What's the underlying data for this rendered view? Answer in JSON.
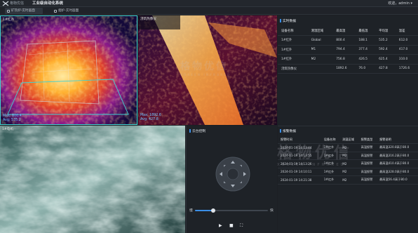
{
  "header": {
    "brand": "格物优信",
    "system_title": "工业级自动化系统",
    "user": "欢迎，admin",
    "user_caret": "▾"
  },
  "tabs": [
    {
      "label": "矿热炉-实时画面",
      "active": true
    },
    {
      "label": "烟炉-实时画面",
      "active": false
    }
  ],
  "videos": {
    "v1": {
      "label": "1#红外",
      "max": "Max: 800.4",
      "avg": "Avg: 535.2"
    },
    "v2": {
      "label": "浇筑热像仪",
      "max": "Max: 1892.6",
      "avg": "Avg: 427.8"
    },
    "v3": {
      "label": "1#电机"
    }
  },
  "watermark": {
    "cn": "格物优信",
    "en": "XOSEEN INFRARED"
  },
  "control": {
    "title": "云台控制",
    "slow_label": "慢",
    "fast_label": "快",
    "speed_value": 0.25,
    "play_icon": "▶",
    "stop_icon": "■",
    "fullscreen_icon": "⛶"
  },
  "realtime": {
    "title": "实时数据",
    "columns": [
      "设备名称",
      "测温区域",
      "最高温",
      "最低温",
      "平均温",
      "温差"
    ],
    "rows": [
      [
        "1#红外",
        "Global",
        "800.4",
        "188.1",
        "535.2",
        "612.0"
      ],
      [
        "1#红外",
        "M1",
        "794.4",
        "377.4",
        "592.4",
        "417.0"
      ],
      [
        "1#红外",
        "M2",
        "756.8",
        "426.5",
        "625.4",
        "310.0"
      ],
      [
        "浇筑热像仪",
        "",
        "1892.6",
        "76.0",
        "427.8",
        "1726.6"
      ]
    ]
  },
  "alarms": {
    "title": "报警数据",
    "columns": [
      "报警时间",
      "设备名称",
      "测温区域",
      "报警类型",
      "报警说明"
    ],
    "rows": [
      [
        "2024-01-19 14:13:44",
        "1#红外",
        "M2",
        "高温报警",
        "最高温320.8高于80.0"
      ],
      [
        "2024-01-19 14:13:55",
        "1#红外",
        "M2",
        "高温报警",
        "最高温316.2高于80.0"
      ],
      [
        "2024-01-19 14:13:26",
        "1#红外",
        "M2",
        "高温报警",
        "最高温410.4高于80.0"
      ],
      [
        "2024-01-19 14:10:11",
        "1#红外",
        "M2",
        "高温报警",
        "最高温328.0高于80.0"
      ],
      [
        "2024-01-19 14:21:38",
        "1#红外",
        "M2",
        "高温报警",
        "最高温56.4高于80.0"
      ]
    ]
  },
  "colors": {
    "accent": "#3a8ee6",
    "panel": "#1e2227",
    "highlight_border": "#3fd3d3"
  }
}
